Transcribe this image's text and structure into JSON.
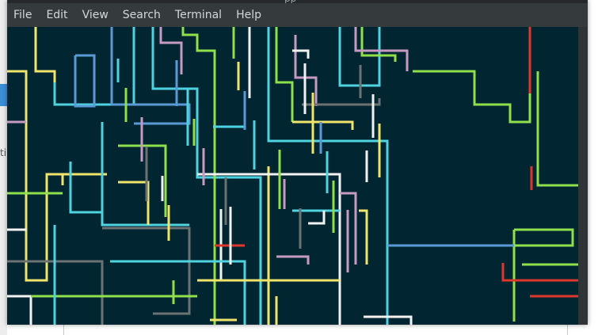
{
  "window": {
    "title_glyph": "pp"
  },
  "menubar": {
    "items": [
      {
        "id": "file",
        "label": "File"
      },
      {
        "id": "edit",
        "label": "Edit"
      },
      {
        "id": "view",
        "label": "View"
      },
      {
        "id": "search",
        "label": "Search"
      },
      {
        "id": "terminal",
        "label": "Terminal"
      },
      {
        "id": "help",
        "label": "Help"
      }
    ]
  },
  "background_app": {
    "partial_label": "ti"
  },
  "terminal": {
    "background": "#022631",
    "program": "pipes screensaver",
    "pipe_colors": {
      "yellow": "#f0e46a",
      "cyan": "#4fd3e0",
      "blue": "#5a9ad6",
      "green": "#8fe04a",
      "pink": "#c79ac4",
      "white": "#f2f2f2",
      "gray": "#6c7272",
      "red": "#e0362c"
    }
  },
  "colors": {
    "menubar_bg": "#353a3c",
    "menu_text": "#d3d7d8",
    "accent_blue": "#3d8fd8"
  }
}
